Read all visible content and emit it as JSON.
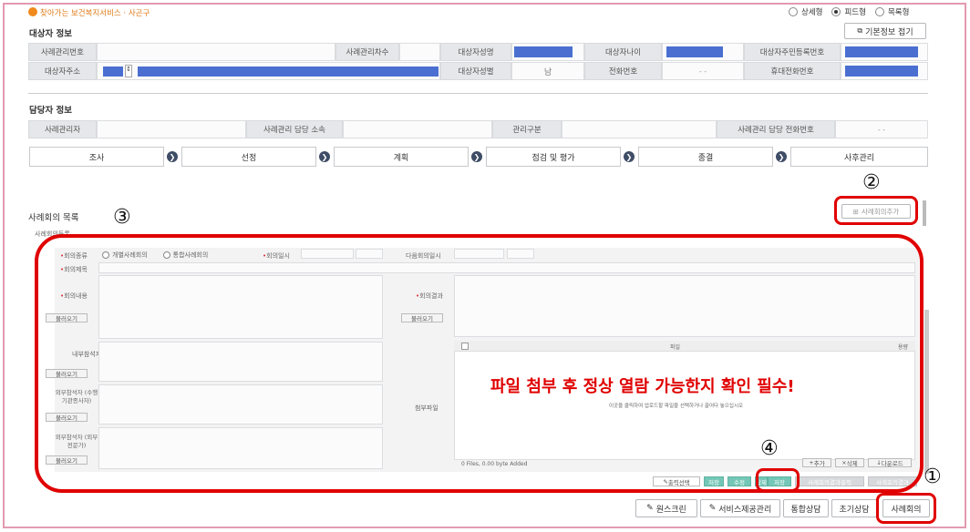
{
  "header": {
    "service_title": "찾아가는 보건복지서비스 · 사곤구",
    "view_options": [
      "상세형",
      "피드형",
      "목록형"
    ],
    "selected_view": "피드형"
  },
  "target_info": {
    "title": "대상자 정보",
    "collapse_button": "기본정보 접기",
    "case_no_label": "사례관리번호",
    "case_count_label": "사례관리차수",
    "name_label": "대상자성명",
    "age_label": "대상자나이",
    "rrn_label": "대상자주민등록번호",
    "address_label": "대상자주소",
    "gender_label": "대상자성별",
    "gender_value": "남",
    "phone_label": "전화번호",
    "phone_value": "-   -",
    "mobile_label": "휴대전화번호"
  },
  "manager_info": {
    "title": "담당자 정보",
    "manager_label": "사례관리자",
    "dept_label": "사례관리 담당 소속",
    "type_label": "관리구분",
    "phone_label": "사례관리 담당 전화번호",
    "phone_value": "-    -"
  },
  "steps": [
    "조사",
    "선정",
    "계획",
    "점검 및 평가",
    "종결",
    "사후관리"
  ],
  "meeting_list": {
    "title": "사례회의 목록",
    "add_button": "사례회의추가",
    "sub_title": "사례회의등록"
  },
  "form": {
    "meeting_type_label": "회의종류",
    "type_option_1": "개별사례회의",
    "type_option_2": "통합사례회의",
    "meeting_date_label": "회의일시",
    "next_date_label": "다음회의일시",
    "subject_label": "회의제목",
    "content_label": "회의내용",
    "result_label": "회의결과",
    "internal_label": "내부참석자",
    "external1_label": "외부참석자 (수행기관종사자)",
    "external2_label": "외부참석자 (외부전문가)",
    "attach_label": "첨부파일",
    "load_button": "불러오기",
    "file_col": "파일",
    "size_col": "용량",
    "drop_hint": "이곳을 클릭하여 업로드할 파일을 선택하거나 끌어다 놓으십시오",
    "file_status": "0 Files, 0.00 byte Added",
    "add_file": "추가",
    "delete_file": "삭제",
    "download_file": "다운로드"
  },
  "warning": "파일 첨부 후 정상 열람 가능한지 확인 필수!",
  "action_bar": {
    "select_all": "출력선택",
    "btn1": "저장",
    "btn2": "수정",
    "btn3": "삭제",
    "btn4": "저장",
    "btn5": "사례회의결과출력",
    "btn6": "사례회의결과"
  },
  "bottom_buttons": [
    "원스크린",
    "서비스제공관리",
    "통합상담",
    "초기상담",
    "사례회의"
  ],
  "annotations": [
    "①",
    "②",
    "③",
    "④"
  ]
}
